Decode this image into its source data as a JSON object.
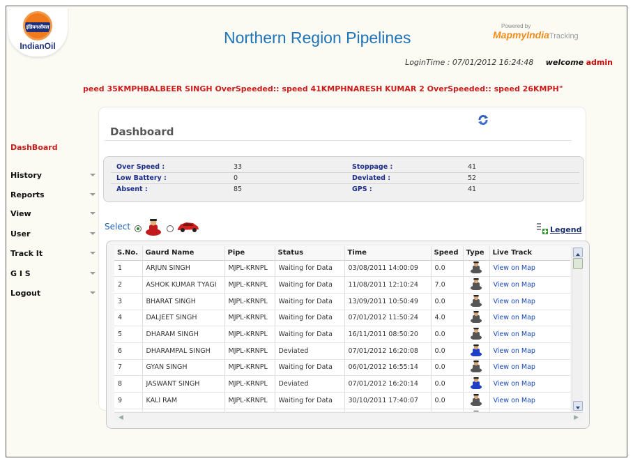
{
  "header": {
    "logo_devanagari": "इंडियनऑयल",
    "logo_text": "IndianOil",
    "title": "Northern Region Pipelines",
    "powered_by": "Powered by",
    "brand": "MapmyIndia",
    "brand_suffix": "Tracking",
    "login_time": "LoginTime : 07/01/2012 16:24:48",
    "welcome": "welcome",
    "username": "admin"
  },
  "ticker": "peed 35KMPHBALBEER SINGH OverSpeeded:: speed 41KMPHNARESH KUMAR 2 OverSpeeded:: speed 26KMPH\"",
  "sidebar": {
    "active": "DashBoard",
    "items": [
      {
        "label": "History"
      },
      {
        "label": "Reports"
      },
      {
        "label": "View"
      },
      {
        "label": "User"
      },
      {
        "label": "Track It"
      },
      {
        "label": "G I S"
      },
      {
        "label": "Logout"
      }
    ]
  },
  "dashboard": {
    "title": "Dashboard",
    "stats": [
      {
        "label": "Over Speed :",
        "value": "33",
        "label2": "Stoppage :",
        "value2": "41"
      },
      {
        "label": "Low Battery :",
        "value": "0",
        "label2": "Deviated :",
        "value2": "52"
      },
      {
        "label": "Absent :",
        "value": "85",
        "label2": "GPS :",
        "value2": "41"
      }
    ],
    "select_label": "Select",
    "legend_label": "Legend",
    "columns": [
      "S.No.",
      "Gaurd Name",
      "Pipe",
      "Status",
      "Time",
      "Speed",
      "Type",
      "Live Track"
    ],
    "rows": [
      {
        "sno": "1",
        "name": "ARJUN SINGH",
        "pipe": "MJPL-KRNPL",
        "status": "Waiting for Data",
        "time": "03/08/2011 14:00:09",
        "speed": "0.0",
        "type": "guard-gray",
        "link": "View on Map"
      },
      {
        "sno": "2",
        "name": "ASHOK KUMAR TYAGI",
        "pipe": "MJPL-KRNPL",
        "status": "Waiting for Data",
        "time": "11/08/2011 12:10:24",
        "speed": "7.0",
        "type": "guard-gray",
        "link": "View on Map"
      },
      {
        "sno": "3",
        "name": "BHARAT SINGH",
        "pipe": "MJPL-KRNPL",
        "status": "Waiting for Data",
        "time": "13/09/2011 10:50:49",
        "speed": "0.0",
        "type": "guard-gray",
        "link": "View on Map"
      },
      {
        "sno": "4",
        "name": "DALJEET SINGH",
        "pipe": "MJPL-KRNPL",
        "status": "Waiting for Data",
        "time": "07/01/2012 11:50:24",
        "speed": "4.0",
        "type": "guard-gray",
        "link": "View on Map"
      },
      {
        "sno": "5",
        "name": "DHARAM SINGH",
        "pipe": "MJPL-KRNPL",
        "status": "Waiting for Data",
        "time": "16/11/2011 08:50:20",
        "speed": "0.0",
        "type": "guard-gray",
        "link": "View on Map"
      },
      {
        "sno": "6",
        "name": "DHARAMPAL SINGH",
        "pipe": "MJPL-KRNPL",
        "status": "Deviated",
        "time": "07/01/2012 16:20:08",
        "speed": "0.0",
        "type": "guard-blue",
        "link": "View on Map"
      },
      {
        "sno": "7",
        "name": "GYAN SINGH",
        "pipe": "MJPL-KRNPL",
        "status": "Waiting for Data",
        "time": "06/01/2012 16:55:14",
        "speed": "0.0",
        "type": "guard-gray",
        "link": "View on Map"
      },
      {
        "sno": "8",
        "name": "JASWANT SINGH",
        "pipe": "MJPL-KRNPL",
        "status": "Deviated",
        "time": "07/01/2012 16:20:14",
        "speed": "0.0",
        "type": "guard-blue",
        "link": "View on Map"
      },
      {
        "sno": "9",
        "name": "KALI RAM",
        "pipe": "MJPL-KRNPL",
        "status": "Waiting for Data",
        "time": "30/10/2011 17:40:07",
        "speed": "0.0",
        "type": "guard-gray",
        "link": "View on Map"
      },
      {
        "sno": "",
        "name": "",
        "pipe": "",
        "status": "",
        "time": "",
        "speed": "",
        "type": "guard-gray",
        "link": ""
      }
    ]
  },
  "colors": {
    "accent_red": "#cc1b1b",
    "title_blue": "#1f73b7",
    "label_navy": "#1b2d8a",
    "link_blue": "#1646b8",
    "guard_blue": "#1f3fc8",
    "guard_gray": "#555555",
    "brand_orange": "#f08c1e"
  }
}
